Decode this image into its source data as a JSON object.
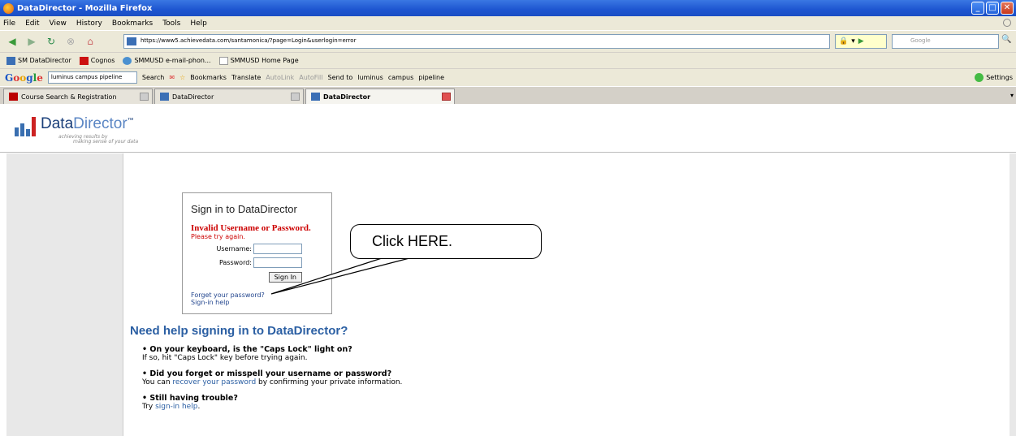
{
  "window": {
    "title": "DataDirector - Mozilla Firefox"
  },
  "menu": [
    "File",
    "Edit",
    "View",
    "History",
    "Bookmarks",
    "Tools",
    "Help"
  ],
  "nav": {
    "url": "https://www5.achievedata.com/santamonica/?page=Login&userlogin=error",
    "search_placeholder": "Google"
  },
  "bookmarks": [
    {
      "label": "SM DataDirector",
      "color": "#3b6fb5"
    },
    {
      "label": "Cognos",
      "color": "#cc1111"
    },
    {
      "label": "SMMUSD e-mail-phon...",
      "color": "#4a90d0"
    },
    {
      "label": "SMMUSD Home Page",
      "color": "#ffffff"
    }
  ],
  "google_toolbar": {
    "query": "luminus campus pipeline",
    "items": [
      "Search",
      "Bookmarks",
      "Translate",
      "AutoLink",
      "AutoFill",
      "Send to",
      "luminus",
      "campus",
      "pipeline"
    ],
    "settings": "Settings"
  },
  "tabs": [
    {
      "label": "Course Search & Registration",
      "active": false
    },
    {
      "label": "DataDirector",
      "active": false
    },
    {
      "label": "DataDirector",
      "active": true
    }
  ],
  "brand": {
    "name_a": "Data",
    "name_b": "Director",
    "tm": "™",
    "tagline1": "achieving results by",
    "tagline2": "making sense of your data"
  },
  "signin": {
    "title": "Sign in to DataDirector",
    "error_title": "Invalid Username or Password.",
    "error_sub": "Please try again.",
    "username_label": "Username:",
    "password_label": "Password:",
    "button": "Sign In",
    "forgot_link": "Forget your password?",
    "help_link": "Sign-in help"
  },
  "callout": {
    "text": "Click HERE."
  },
  "help": {
    "heading": "Need help signing in to DataDirector?",
    "items": [
      {
        "title": "On your keyboard, is the \"Caps Lock\" light on?",
        "pre": "If so, hit \"Caps Lock\" key before trying again.",
        "link": "",
        "post": ""
      },
      {
        "title": "Did you forget or misspell your username or password?",
        "pre": "You can ",
        "link": "recover your password",
        "post": " by confirming your private information."
      },
      {
        "title": "Still having trouble?",
        "pre": "Try ",
        "link": "sign-in help",
        "post": "."
      }
    ]
  }
}
